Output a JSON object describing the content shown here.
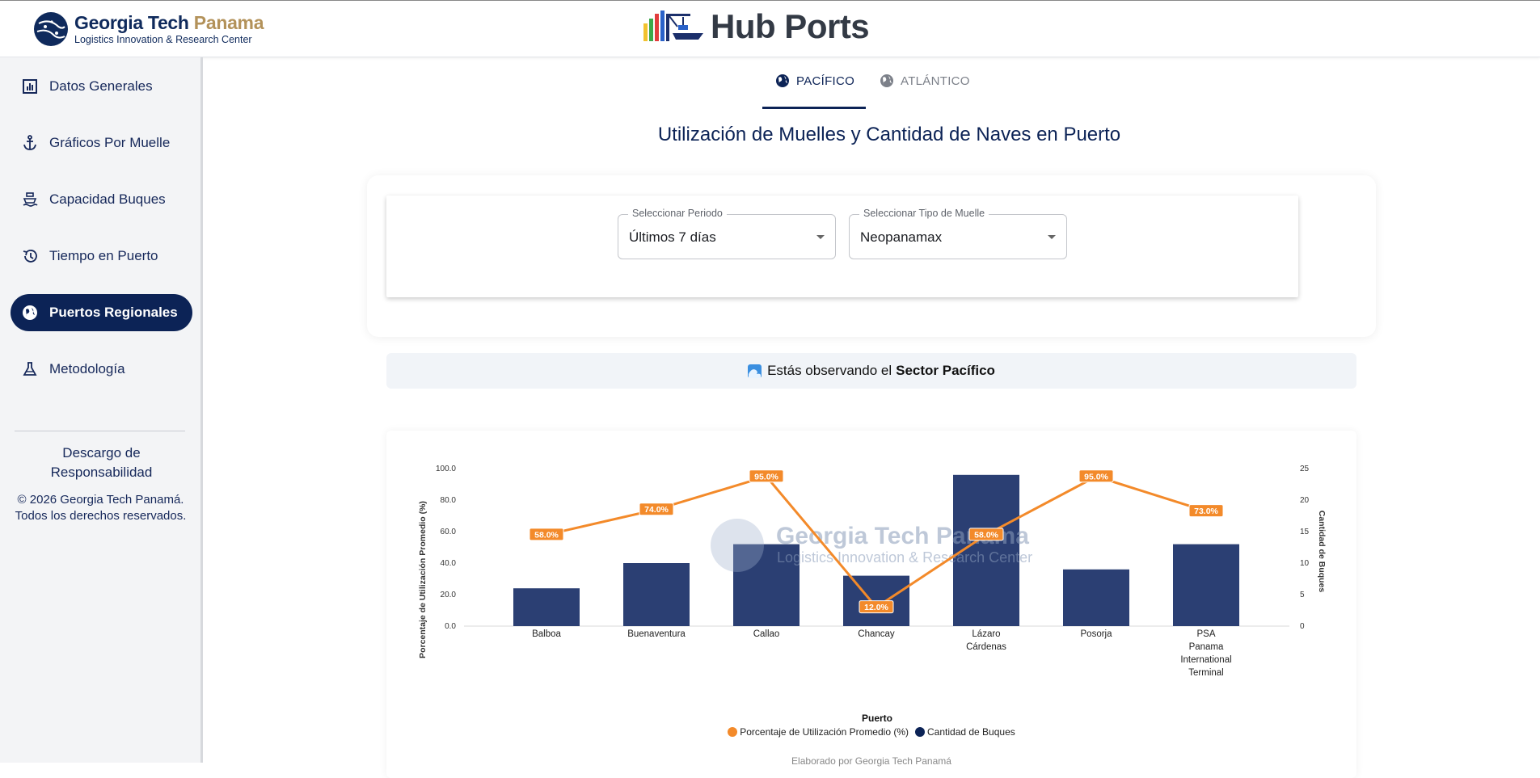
{
  "header": {
    "brand_name": "Georgia Tech",
    "brand_accent": "Panama",
    "brand_subtitle": "Logistics Innovation & Research Center",
    "app_title": "Hub Ports"
  },
  "sidebar": {
    "items": [
      {
        "label": "Datos Generales",
        "icon": "bar-chart-icon"
      },
      {
        "label": "Gráficos Por Muelle",
        "icon": "anchor-icon"
      },
      {
        "label": "Capacidad Buques",
        "icon": "ship-icon"
      },
      {
        "label": "Tiempo en Puerto",
        "icon": "history-icon"
      },
      {
        "label": "Puertos Regionales",
        "icon": "globe-icon",
        "active": true
      },
      {
        "label": "Metodología",
        "icon": "flask-icon"
      }
    ],
    "disclaimer": "Descargo de Responsabilidad",
    "copyright": "© 2026 Georgia Tech Panamá. Todos los derechos reservados."
  },
  "tabs": [
    {
      "label": "PACÍFICO",
      "selected": true
    },
    {
      "label": "ATLÁNTICO",
      "selected": false
    }
  ],
  "page_title": "Utilización de Muelles y Cantidad de Naves en Puerto",
  "filters": {
    "periodo": {
      "legend": "Seleccionar Periodo",
      "value": "Últimos 7 días"
    },
    "tipo_muelle": {
      "legend": "Seleccionar Tipo de Muelle",
      "value": "Neopanamax"
    }
  },
  "banner": {
    "prefix": "Estás observando el",
    "highlight": "Sector Pacífico"
  },
  "colors": {
    "primary": "#0c2356",
    "bar": "#2b3f73",
    "line": "#f38a2a"
  },
  "chart_data": {
    "type": "bar",
    "xlabel": "Puerto",
    "ylabel_left": "Porcentaje de Utilización Promedio (%)",
    "ylabel_right": "Cantidad de Buques",
    "categories": [
      [
        "Balboa"
      ],
      [
        "Buenaventura"
      ],
      [
        "Callao"
      ],
      [
        "Chancay"
      ],
      [
        "Lázaro",
        "Cárdenas"
      ],
      [
        "Posorja"
      ],
      [
        "PSA",
        "Panama",
        "International",
        "Terminal"
      ]
    ],
    "left_ticks": [
      "0.0",
      "20.0",
      "40.0",
      "60.0",
      "80.0",
      "100.0"
    ],
    "right_ticks": [
      "0",
      "5",
      "10",
      "15",
      "20",
      "25"
    ],
    "ylim_left": [
      0,
      100
    ],
    "ylim_right": [
      0,
      25
    ],
    "series": [
      {
        "name": "Cantidad de Buques",
        "type": "bar",
        "axis": "right",
        "values": [
          6,
          10,
          13,
          8,
          24,
          9,
          13
        ]
      },
      {
        "name": "Porcentaje de Utilización Promedio (%)",
        "type": "line",
        "axis": "left",
        "values": [
          58.0,
          74.0,
          95.0,
          12.0,
          58.0,
          95.0,
          73.0
        ],
        "labels": [
          "58.0%",
          "74.0%",
          "95.0%",
          "12.0%",
          "58.0%",
          "95.0%",
          "73.0%"
        ]
      }
    ],
    "watermark_line1": "Georgia Tech Panama",
    "watermark_line2": "Logistics Innovation & Research Center"
  },
  "footer_note": "Elaborado por Georgia Tech Panamá"
}
